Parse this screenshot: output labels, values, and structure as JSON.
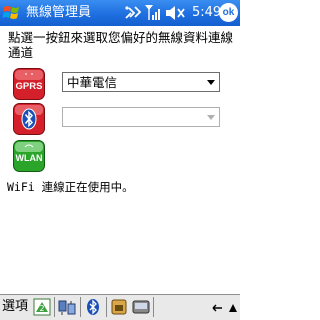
{
  "titlebar": {
    "title": "無線管理員",
    "time": "5:49",
    "ok_label": "ok",
    "icons": [
      "start-icon",
      "connectivity-icon",
      "signal-icon",
      "volume-icon",
      "ok-icon"
    ]
  },
  "content": {
    "instruction": "點選一按鈕來選取您偏好的無線資料連線通道",
    "gprs": {
      "icon_label": "GPRS",
      "selected": "中華電信"
    },
    "bluetooth": {
      "selected": ""
    },
    "wlan": {
      "icon_label": "WLAN"
    },
    "status": "WiFi 連線正在使用中。"
  },
  "menubar": {
    "options_label": "選項",
    "icons": [
      "help-icon",
      "network-icon",
      "bluetooth-icon",
      "sim-icon",
      "media-icon",
      "keyboard-icon"
    ]
  },
  "colors": {
    "titlebar": "#1e6fe0",
    "gprs": "#d4202a",
    "bluetooth": "#d4202a",
    "wlan": "#2aa52a"
  }
}
